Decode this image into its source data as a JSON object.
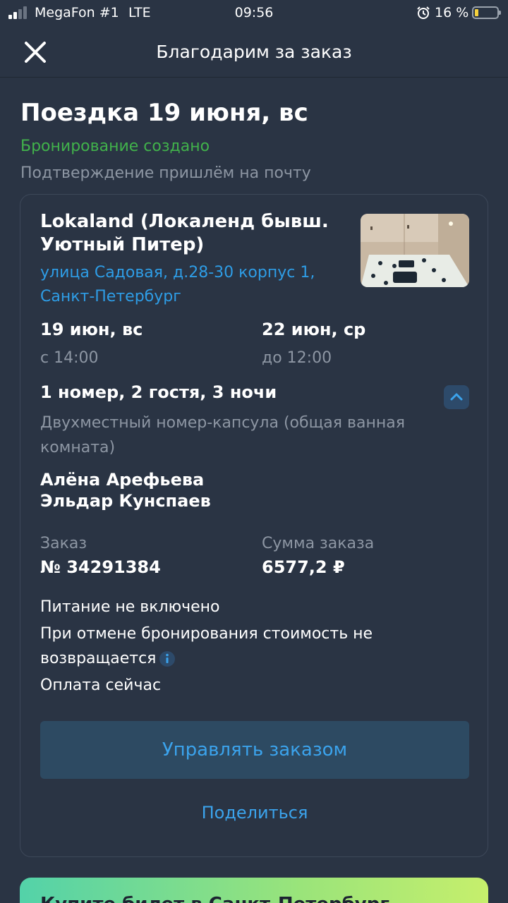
{
  "status_bar": {
    "carrier": "MegaFon #1",
    "network": "LTE",
    "time": "09:56",
    "battery": "16 %",
    "battery_color": "#f5d13c"
  },
  "header": {
    "title": "Благодарим за заказ",
    "close_icon": "close-icon"
  },
  "trip": {
    "title": "Поездка 19 июня, вс",
    "status": "Бронирование создано",
    "status_color": "#41b24b",
    "confirmation_note": "Подтверждение пришлём на почту"
  },
  "booking": {
    "hotel_name": "Lokaland (Локаленд бывш. Уютный Питер)",
    "address": "улица Садовая, д.28-30 корпус 1, Санкт-Петербург",
    "checkin": {
      "date": "19 июн, вс",
      "time": "с 14:00"
    },
    "checkout": {
      "date": "22 июн, ср",
      "time": "до 12:00"
    },
    "room_summary": "1 номер, 2 гостя, 3 ночи",
    "room_type": "Двухместный номер-капсула (общая ванная комната)",
    "guests": [
      "Алёна Арефьева",
      "Эльдар Кунспаев"
    ],
    "order_label": "Заказ",
    "order_number": "№ 34291384",
    "sum_label": "Сумма заказа",
    "sum_value": "6577,2 ₽",
    "conditions": {
      "meals": "Питание не включено",
      "cancellation": "При отмене бронирования стоимость не возвращается",
      "payment": "Оплата сейчас"
    },
    "manage_button": "Управлять заказом",
    "share_link": "Поделиться"
  },
  "promo": {
    "text": "Купите билет в Санкт-Петербург"
  },
  "colors": {
    "background": "#2a3444",
    "accent": "#3ba3ec",
    "muted": "#8d96a3"
  }
}
